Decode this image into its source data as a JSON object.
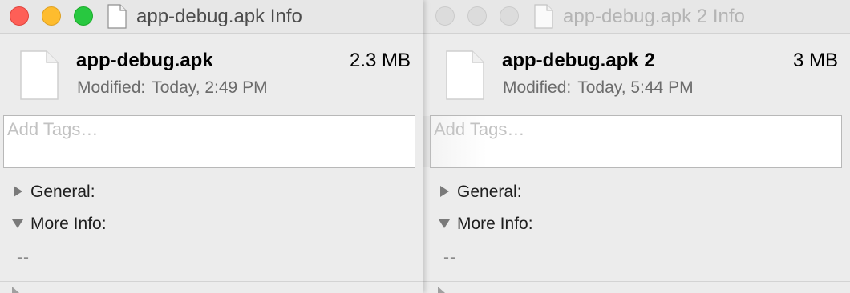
{
  "windows": [
    {
      "title": "app-debug.apk Info",
      "file_name": "app-debug.apk",
      "file_size": "2.3 MB",
      "modified_label": "Modified:",
      "modified_value": "Today, 2:49 PM",
      "tags_placeholder": "Add Tags…",
      "general_label": "General:",
      "more_info_label": "More Info:",
      "more_info_value": "--",
      "active": true
    },
    {
      "title": "app-debug.apk 2 Info",
      "file_name": "app-debug.apk 2",
      "file_size": "3 MB",
      "modified_label": "Modified:",
      "modified_value": "Today, 5:44 PM",
      "tags_placeholder": "Add Tags…",
      "general_label": "General:",
      "more_info_label": "More Info:",
      "more_info_value": "--",
      "active": false
    }
  ],
  "colors": {
    "close": "#fe5f57",
    "minimize": "#febc2e",
    "zoom": "#28c840",
    "inactive_light": "#dcdcdc"
  },
  "icons": [
    "document-icon",
    "disclosure-right-icon",
    "disclosure-down-icon"
  ]
}
